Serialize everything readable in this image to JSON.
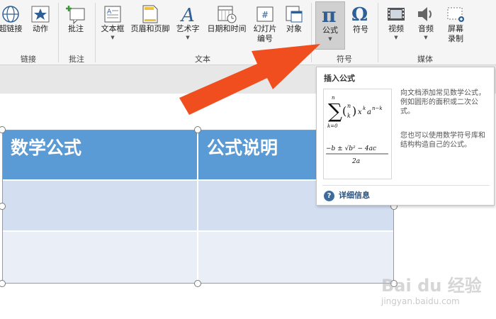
{
  "ribbon": {
    "buttons": {
      "hyperlink": "超链接",
      "action": "动作",
      "comment": "批注",
      "textbox": "文本框",
      "header_footer": "页眉和页脚",
      "wordart": "艺术字",
      "datetime": "日期和时间",
      "slide_number_1": "幻灯片",
      "slide_number_2": "编号",
      "object": "对象",
      "equation": "公式",
      "symbol": "符号",
      "video": "视频",
      "audio": "音频",
      "screen_rec_1": "屏幕",
      "screen_rec_2": "录制"
    },
    "groups": {
      "links": "链接",
      "comments": "批注",
      "text": "文本",
      "symbols": "符号",
      "media": "媒体"
    }
  },
  "table": {
    "headers": [
      "数学公式",
      "公式说明"
    ],
    "rows": [
      [
        "",
        ""
      ],
      [
        "",
        ""
      ]
    ]
  },
  "tooltip": {
    "title": "插入公式",
    "desc1": "向文档添加常见数学公式，例如圆形的面积或二次公式。",
    "desc2": "您也可以使用数学符号库和结构构造自己的公式。",
    "link": "详细信息"
  },
  "watermark": {
    "logo": "Bai du 经验",
    "url": "jingyan.baidu.com"
  },
  "colors": {
    "table_header": "#5b9bd5",
    "row_light": "#d3dff0",
    "row_lighter": "#e9eef7",
    "arrow": "#f04e1e"
  }
}
